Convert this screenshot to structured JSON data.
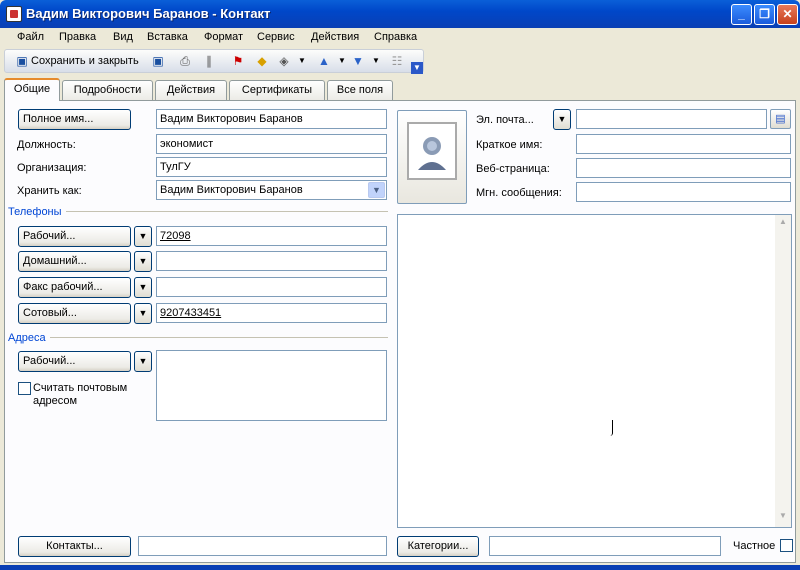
{
  "window": {
    "title": "Вадим Викторович Баранов - Контакт",
    "minimize": "_",
    "restore": "❐",
    "close": "✕"
  },
  "menu": [
    {
      "label": "Файл"
    },
    {
      "label": "Правка"
    },
    {
      "label": "Вид"
    },
    {
      "label": "Вставка"
    },
    {
      "label": "Формат"
    },
    {
      "label": "Сервис"
    },
    {
      "label": "Действия"
    },
    {
      "label": "Справка"
    }
  ],
  "toolbar": {
    "save_close": "Сохранить и закрыть"
  },
  "tabs": [
    "Общие",
    "Подробности",
    "Действия",
    "Сертификаты",
    "Все поля"
  ],
  "general": {
    "fullname_button": "Полное имя...",
    "fullname_value": "Вадим Викторович Баранов",
    "position_label": "Должность:",
    "position_value": "экономист",
    "org_label": "Организация:",
    "org_value": "ТулГУ",
    "fileas_label": "Хранить как:",
    "fileas_value": "Вадим Викторович Баранов"
  },
  "phones": {
    "section": "Телефоны",
    "work_btn": "Рабочий...",
    "work_value": "72098",
    "home_btn": "Домашний...",
    "home_value": "",
    "fax_btn": "Факс рабочий...",
    "fax_value": "",
    "mobile_btn": "Сотовый...",
    "mobile_value": "9207433451"
  },
  "address": {
    "section": "Адреса",
    "work_btn": "Рабочий...",
    "mailing_check": "Считать почтовым адресом"
  },
  "right": {
    "email_btn": "Эл. почта...",
    "display_label": "Краткое имя:",
    "web_label": "Веб-страница:",
    "im_label": "Мгн. сообщения:"
  },
  "bottom": {
    "contacts_btn": "Контакты...",
    "categories_btn": "Категории...",
    "private_label": "Частное"
  }
}
